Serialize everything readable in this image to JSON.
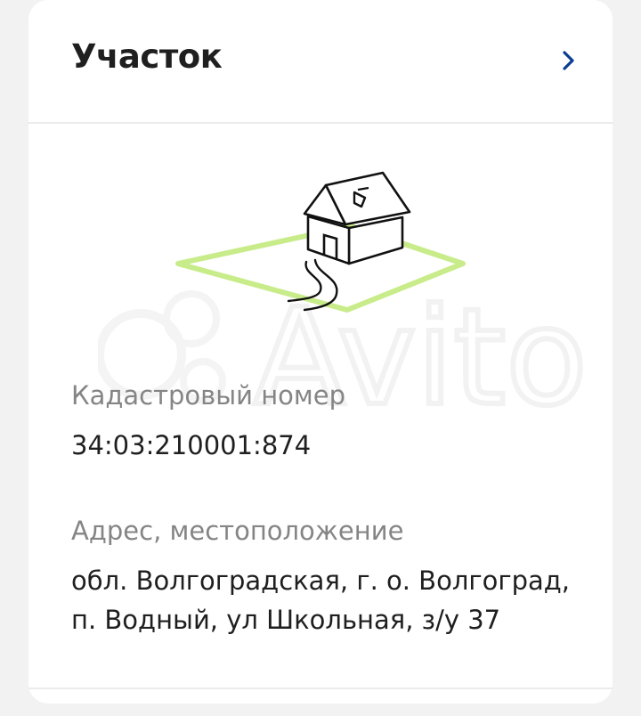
{
  "section": {
    "title": "Участок"
  },
  "cadastral": {
    "label": "Кадастровый номер",
    "value": "34:03:210001:874"
  },
  "address": {
    "label": "Адрес, местоположение",
    "line1": "обл. Волгоградская, г. о. Волгоград,",
    "line2": "п. Водный, ул Школьная, з/у 37"
  },
  "watermark": {
    "text": "Avito"
  },
  "icons": {
    "chevron": "chevron-right-icon",
    "illustration": "house-plot-illustration"
  },
  "colors": {
    "accent": "#0a3d91",
    "plot_green": "#c8ec8a",
    "text_primary": "#1f1f1f",
    "text_secondary": "#858585"
  }
}
